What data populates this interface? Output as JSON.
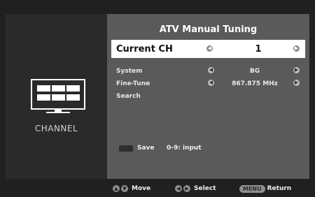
{
  "screen": {
    "title": "ATV Manual Tuning",
    "sidebar_label": "CHANNEL",
    "current_ch": {
      "label": "Current CH",
      "value": "1"
    },
    "rows": [
      {
        "label": "System",
        "value": "BG"
      },
      {
        "label": "Fine-Tune",
        "value": "867.875 MHz"
      },
      {
        "label": "Search",
        "value": ""
      }
    ],
    "save_label": "Save",
    "input_hint": "0-9: input",
    "footer": {
      "move": "Move",
      "select": "Select",
      "menu_key": "MENU",
      "return": "Return"
    }
  },
  "icons": {
    "tv": "tv-icon",
    "left": "left-arrow-icon",
    "right": "right-arrow-icon",
    "updown": "up-down-icon"
  },
  "colors": {
    "panel": "#5a5a5a",
    "sidebar": "#2a2a2a",
    "highlight": "#ffffff",
    "text": "#e8e8e8"
  }
}
